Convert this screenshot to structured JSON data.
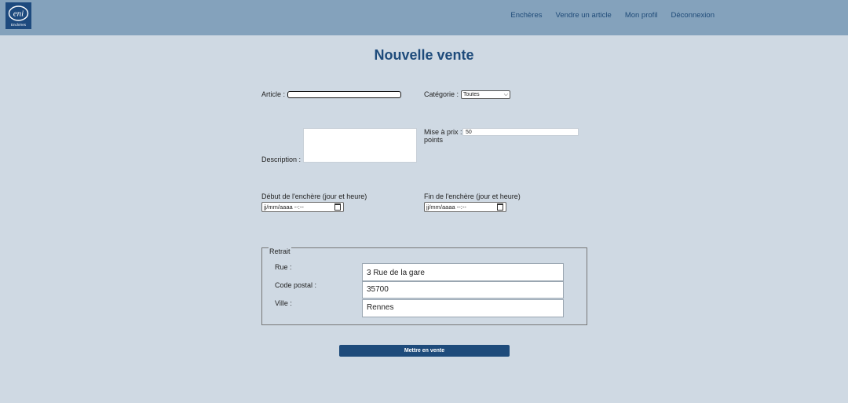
{
  "navbar": {
    "logo": {
      "text": "eni",
      "subtext": "Enchères"
    },
    "links": [
      {
        "label": "Enchères"
      },
      {
        "label": "Vendre un article"
      },
      {
        "label": "Mon profil"
      },
      {
        "label": "Déconnexion"
      }
    ]
  },
  "page": {
    "title": "Nouvelle vente"
  },
  "form": {
    "article": {
      "label": "Article :",
      "value": ""
    },
    "categorie": {
      "label": "Catégorie :",
      "selected": "Toutes"
    },
    "description": {
      "label": "Description :",
      "value": ""
    },
    "mise_a_prix": {
      "label": "Mise à prix :",
      "value": "50",
      "unit": "points"
    },
    "debut": {
      "label": "Début de l'enchère (jour et heure)",
      "placeholder": "jj/mm/aaaa --:--"
    },
    "fin": {
      "label": "Fin de l'enchère (jour et heure)",
      "placeholder": "jj/mm/aaaa --:--"
    },
    "retrait": {
      "legend": "Retrait",
      "rue": {
        "label": "Rue :",
        "value": "3 Rue de la gare"
      },
      "code_postal": {
        "label": "Code postal :",
        "value": "35700"
      },
      "ville": {
        "label": "Ville :",
        "value": "Rennes"
      }
    },
    "submit_label": "Mettre en vente"
  },
  "colors": {
    "navbar": "#84a2bc",
    "background": "#cfd9e3",
    "accent": "#1e4b7b"
  }
}
